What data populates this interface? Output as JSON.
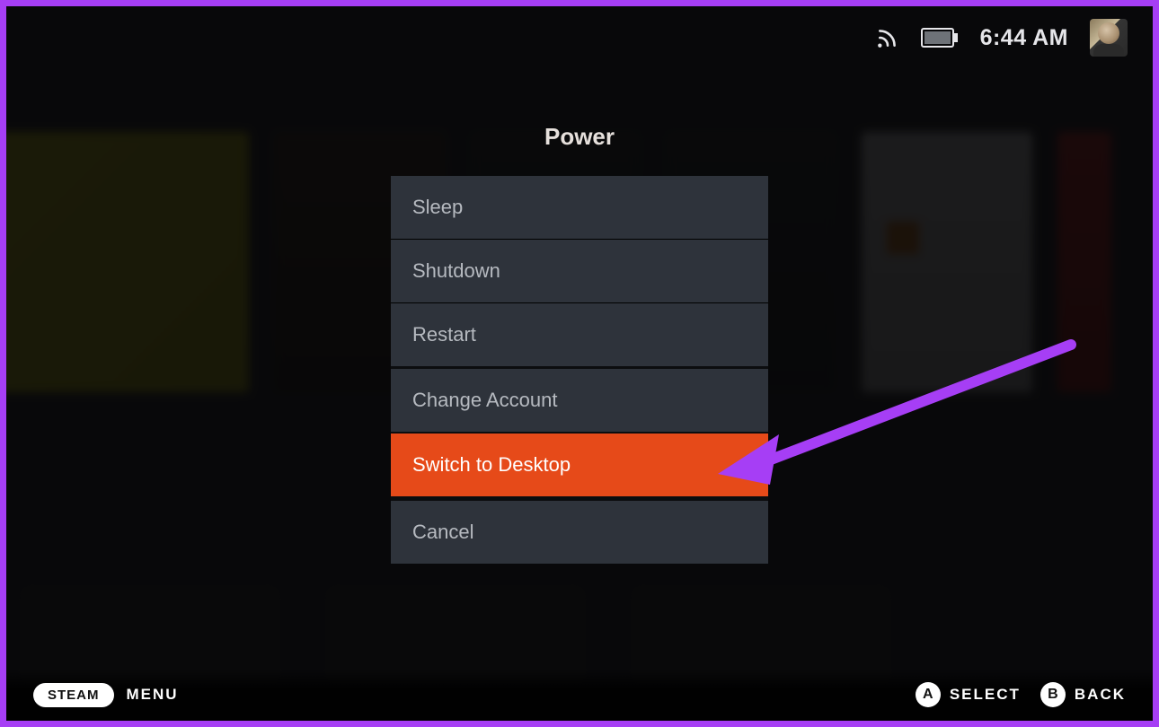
{
  "colors": {
    "frame": "#a63ef5",
    "menu_bg": "#2e333b",
    "menu_sep": "#0c0d0f",
    "highlight": "#e64a19",
    "arrow": "#a63ef5"
  },
  "header": {
    "wifi_icon": "wifi-icon",
    "battery_icon": "battery-icon",
    "time": "6:44 AM"
  },
  "dialog": {
    "title": "Power",
    "items": [
      {
        "label": "Sleep",
        "selected": false
      },
      {
        "label": "Shutdown",
        "selected": false
      },
      {
        "label": "Restart",
        "selected": false
      },
      {
        "label": "Change Account",
        "selected": false
      },
      {
        "label": "Switch to Desktop",
        "selected": true
      },
      {
        "label": "Cancel",
        "selected": false
      }
    ]
  },
  "footer": {
    "steam_button": "STEAM",
    "menu_label": "MENU",
    "hints": [
      {
        "button": "A",
        "label": "SELECT"
      },
      {
        "button": "B",
        "label": "BACK"
      }
    ]
  }
}
